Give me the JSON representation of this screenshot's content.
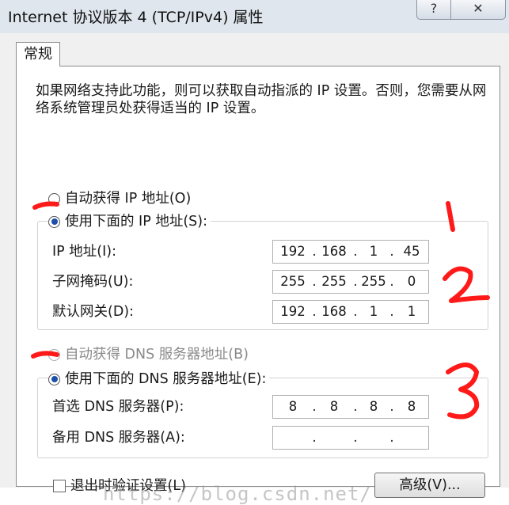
{
  "window": {
    "title": "Internet 协议版本 4 (TCP/IPv4) 属性",
    "help_label": "?",
    "close_label": "✕"
  },
  "tabs": [
    {
      "label": "常规",
      "selected": true
    }
  ],
  "description": "如果网络支持此功能，则可以获取自动指派的 IP 设置。否则，您需要从网络系统管理员处获得适当的 IP 设置。",
  "ip_section": {
    "auto_option": {
      "label": "自动获得 IP 地址(O)",
      "selected": false
    },
    "manual_option": {
      "label": "使用下面的 IP 地址(S):",
      "selected": true
    },
    "fields": [
      {
        "label": "IP 地址(I):",
        "octets": [
          "192",
          "168",
          "1",
          "45"
        ]
      },
      {
        "label": "子网掩码(U):",
        "octets": [
          "255",
          "255",
          "255",
          "0"
        ]
      },
      {
        "label": "默认网关(D):",
        "octets": [
          "192",
          "168",
          "1",
          "1"
        ]
      }
    ]
  },
  "dns_section": {
    "auto_option": {
      "label": "自动获得 DNS 服务器地址(B)",
      "selected": false,
      "disabled": true
    },
    "manual_option": {
      "label": "使用下面的 DNS 服务器地址(E):",
      "selected": true
    },
    "fields": [
      {
        "label": "首选 DNS 服务器(P):",
        "octets": [
          "8",
          "8",
          "8",
          "8"
        ]
      },
      {
        "label": "备用 DNS 服务器(A):",
        "octets": [
          "",
          "",
          "",
          ""
        ]
      }
    ]
  },
  "validate_checkbox": {
    "label": "退出时验证设置(L)",
    "checked": false
  },
  "advanced_button": {
    "label": "高级(V)..."
  },
  "watermark": "https://blog.csdn.net/",
  "annotations": {
    "numbers": [
      "1",
      "2",
      "3"
    ],
    "color": "#ff1a1a"
  }
}
